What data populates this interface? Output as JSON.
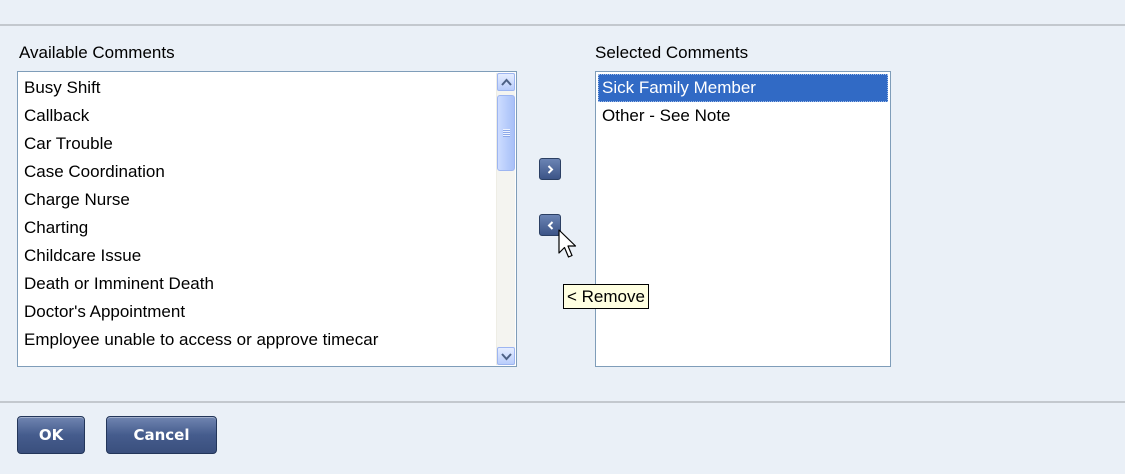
{
  "available": {
    "label": "Available Comments",
    "items": [
      "Busy Shift",
      "Callback",
      "Car Trouble",
      "Case Coordination",
      "Charge Nurse",
      "Charting",
      "Childcare Issue",
      "Death or Imminent Death",
      "Doctor's Appointment",
      "Employee unable to access or approve timecar"
    ]
  },
  "selected": {
    "label": "Selected Comments",
    "items": [
      "Sick Family Member",
      "Other - See Note"
    ],
    "highlighted_index": 0
  },
  "icons": {
    "add": "chevron-right-icon",
    "remove": "chevron-left-icon",
    "scroll_up": "chevron-up-icon",
    "scroll_down": "chevron-down-icon",
    "pointer": "mouse-pointer-icon"
  },
  "tooltip": {
    "text": "< Remove"
  },
  "buttons": {
    "ok": "OK",
    "cancel": "Cancel"
  },
  "colors": {
    "background": "#eaf0f7",
    "selection": "#316ac5",
    "button": "#455c8d",
    "tooltip_bg": "#ffffe1"
  }
}
